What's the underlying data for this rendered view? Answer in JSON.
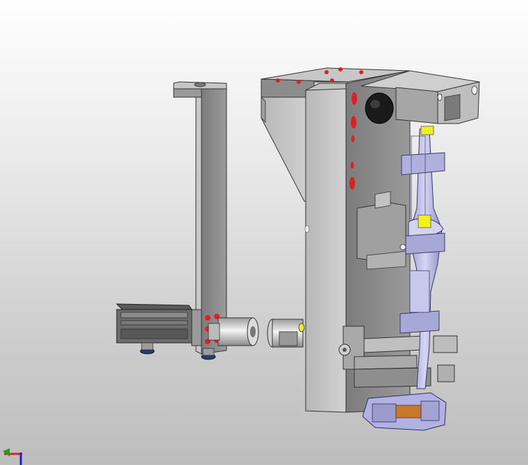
{
  "viewport": {
    "background_top": "#ffffff",
    "background_bottom": "#bdbdbd"
  },
  "model": {
    "part_color": "#8f8f8f",
    "part_dark": "#5e5e5e",
    "part_light": "#b9b9b9",
    "hole_color": "#e02020",
    "assembly_color": "#b8b8e8",
    "highlight_yellow": "#f2f21a",
    "accent_orange": "#c8782a"
  },
  "triad": {
    "x_axis_color": "#d81e1e",
    "y_axis_color": "#1e9e1e",
    "z_axis_color": "#1e1ed8"
  }
}
